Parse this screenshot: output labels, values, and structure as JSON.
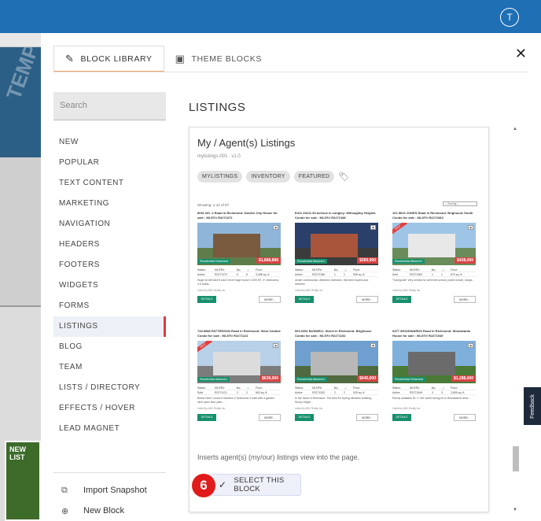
{
  "topbar": {
    "avatar_initial": "T",
    "color": "#1f6fb5"
  },
  "background": {
    "banner_text": "TEMPLATE",
    "thumb_label": "NEW LIST"
  },
  "modal": {
    "tabs": [
      {
        "label": "BLOCK LIBRARY",
        "icon": "magic-wand-icon",
        "active": true
      },
      {
        "label": "THEME BLOCKS",
        "icon": "theme-blocks-icon",
        "active": false
      }
    ],
    "close_icon": "close-icon"
  },
  "sidebar": {
    "search_placeholder": "Search",
    "categories": [
      "NEW",
      "POPULAR",
      "TEXT CONTENT",
      "MARKETING",
      "NAVIGATION",
      "HEADERS",
      "FOOTERS",
      "WIDGETS",
      "FORMS",
      "LISTINGS",
      "BLOG",
      "TEAM",
      "LISTS / DIRECTORY",
      "EFFECTS / HOVER",
      "LEAD MAGNET"
    ],
    "active_category": "LISTINGS",
    "bottom": {
      "import_label": "Import Snapshot",
      "new_block_label": "New Block"
    }
  },
  "main": {
    "title": "LISTINGS",
    "card": {
      "title": "My / Agent(s) Listings",
      "subtitle": "mylistings-001 . v1.0",
      "tags": [
        "MYLISTINGS",
        "INVENTORY",
        "FEATURED"
      ],
      "description": "Inserts agent(s) (my/our) listings view into the page.",
      "select_label": "SELECT THIS BLOCK",
      "step_number": "6"
    },
    "preview": {
      "showing": "Showing: 1-12 of 97",
      "sort_label": "-- Sort by --",
      "listings": [
        {
          "title": "8091 NO. 4 Road in Richmond: Garden City House for sale : MLS®# R2271072",
          "type": "Residential Detached",
          "price": "$1,888,888",
          "ribbon": "",
          "stats": [
            "Active",
            "R2271072",
            "6",
            "6",
            "3,358 sq. ft."
          ],
          "desc": "Huge lot 66'x164'5 and 2 level huge house 3,305 SF, 4+ bedrooms, 4.5 baths...",
          "listed": "Listed by ABC Realty Inc."
        },
        {
          "title": "E411 20211 66 Avenue in Langley: Willoughby Heights Condo for sale : MLS®# R2272186",
          "type": "Residential Attached",
          "price": "$369,900",
          "ribbon": "",
          "stats": [
            "Active",
            "R2272186",
            "1",
            "1",
            "535 sq. ft."
          ],
          "desc": "Under construction. Attention investors, first time buyers and retirees!",
          "listed": "Listed by ABC Realty Inc."
        },
        {
          "title": "101 8620 JONES Road in Richmond: Brighouse South Condo for sale : MLS®# R2271063",
          "type": "Residential Attached",
          "price": "$428,000",
          "ribbon": "SOLD",
          "stats": [
            "Sold",
            "R2271063",
            "1",
            "1",
            "870 sq. ft."
          ],
          "desc": "\"Sunnyside\" very central for all levels school, public transit, shops...",
          "listed": "Listed by ABC Realty Inc."
        },
        {
          "title": "728 8988 PATTERSON Road in Richmond: West Cambie Condo for sale : MLS®# R2271121",
          "type": "Residential Attached",
          "price": "$639,000",
          "ribbon": "SOLD",
          "stats": [
            "Sold",
            "R2271121",
            "2",
            "2",
            "843 sq. ft."
          ],
          "desc": "Brand New Concord Gardens 2 bedrooms 2 bath with a garden view open floor plan...",
          "listed": "Listed by ABC Realty Inc."
        },
        {
          "title": "903 6351 BUSWELL Street in Richmond: Brighouse Condo for sale : MLS®# R2271152",
          "type": "Residential Attached",
          "price": "$645,000",
          "ribbon": "",
          "stats": [
            "Active",
            "R2271152",
            "2",
            "2",
            "920 sq. ft."
          ],
          "desc": "In the heart of Richmond. The best 50 Spring direction building. Sunny bright...",
          "listed": "Listed by ABC Realty Inc."
        },
        {
          "title": "6377 WOODWARDS Road in Richmond: Woodwards House for sale : MLS®# R2271549",
          "type": "Residential Detached",
          "price": "$1,288,000",
          "ribbon": "",
          "stats": [
            "Active",
            "R2271549",
            "3",
            "3",
            "2,809 sq. ft."
          ],
          "desc": "Rarely available 81' x 140' south facing lot in Woodwards area...",
          "listed": "Listed by ABC Realty Inc."
        }
      ],
      "stat_headers": [
        "Status:",
        "MLS®#:",
        "🛏",
        "🛁",
        "Floor:"
      ],
      "details_label": "DETAILS",
      "more_label": "MORE..."
    }
  },
  "feedback_label": "Feedback",
  "colors": {
    "accent_red": "#e11b1b",
    "green": "#188f6c",
    "tab_underline": "#f0a26b"
  }
}
